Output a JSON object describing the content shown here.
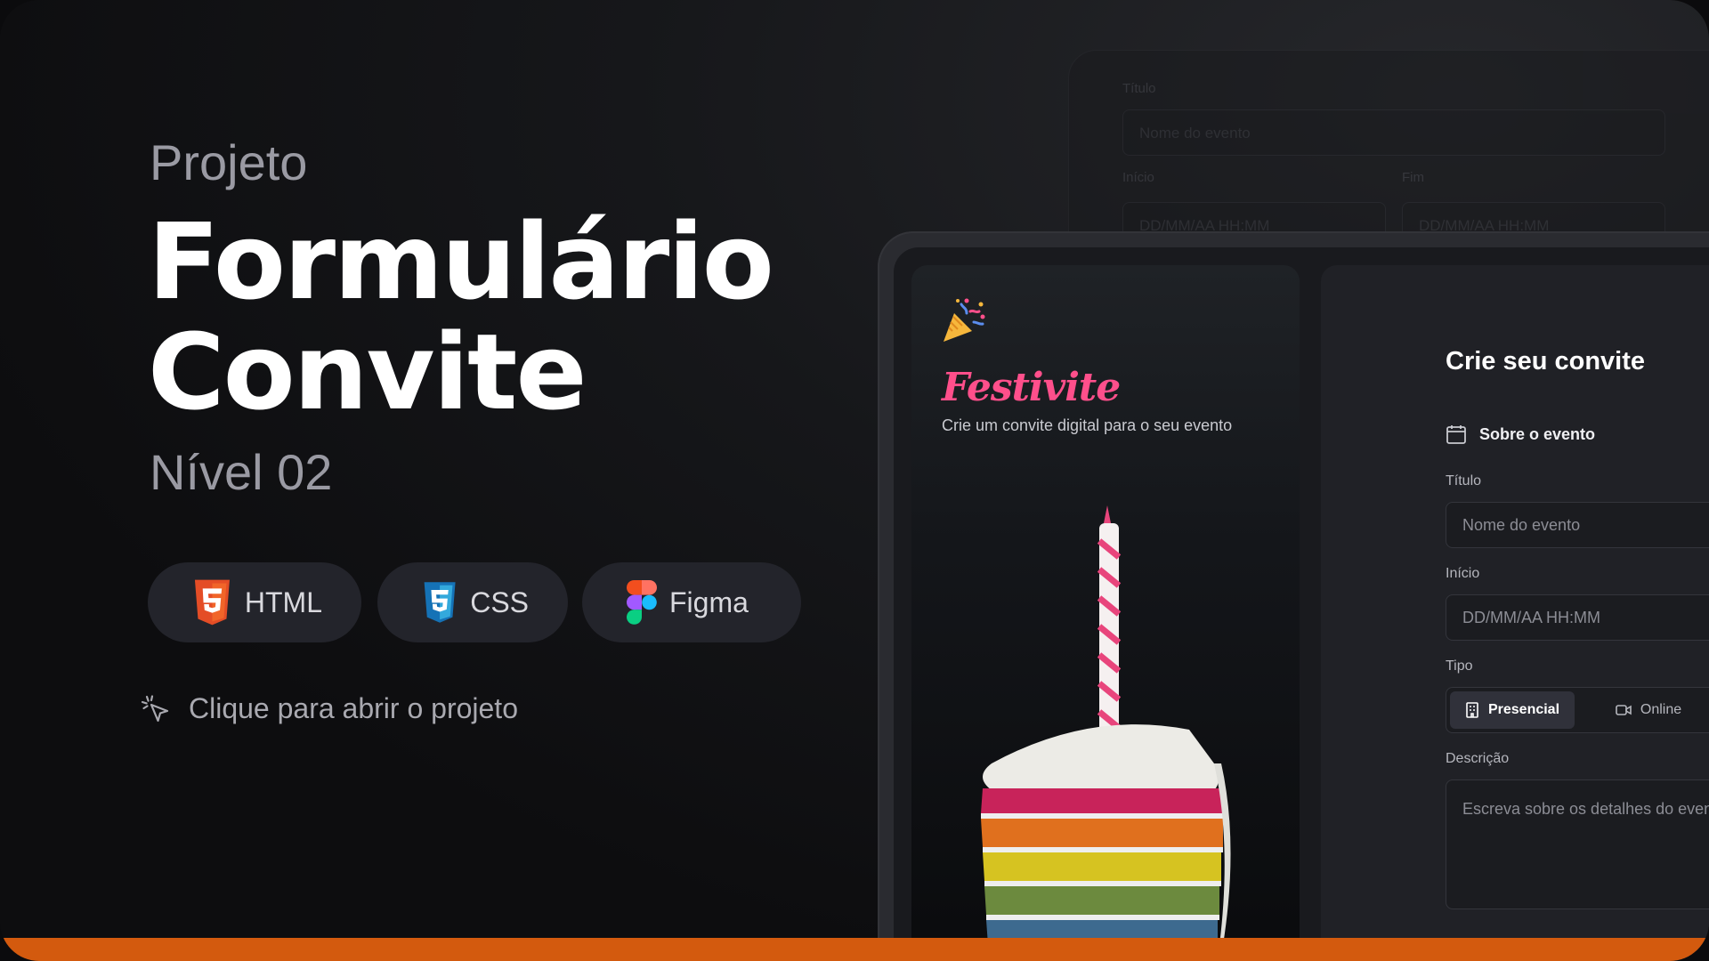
{
  "hero": {
    "kicker": "Projeto",
    "title_line1": "Formulário",
    "title_line2": "Convite",
    "level": "Nível 02"
  },
  "tech_pills": [
    {
      "label": "HTML",
      "icon": "html5-icon",
      "color": "#e44d26"
    },
    {
      "label": "CSS",
      "icon": "css3-icon",
      "color": "#2a7ae4"
    },
    {
      "label": "Figma",
      "icon": "figma-icon",
      "color": "#f24e1e"
    }
  ],
  "open_project": {
    "label": "Clique para abrir o projeto",
    "icon": "cursor-click-icon"
  },
  "ghost_form": {
    "title_label": "Título",
    "title_placeholder": "Nome do evento",
    "start_label": "Início",
    "end_label": "Fim",
    "start_placeholder": "DD/MM/AA HH:MM",
    "end_placeholder": "DD/MM/AA HH:MM"
  },
  "app": {
    "brand": "Festivite",
    "tagline": "Crie um convite digital para o seu evento",
    "brand_color": "#ff4f8b"
  },
  "form": {
    "heading": "Crie seu convite",
    "section": "Sobre o evento",
    "title_label": "Título",
    "title_placeholder": "Nome do evento",
    "start_label": "Início",
    "start_placeholder": "DD/MM/AA HH:MM",
    "type_label": "Tipo",
    "type_options": [
      "Presencial",
      "Online"
    ],
    "type_selected": "Presencial",
    "description_label": "Descrição",
    "description_placeholder": "Escreva sobre os detalhes do evento"
  },
  "accent_color": "#d35a0e"
}
